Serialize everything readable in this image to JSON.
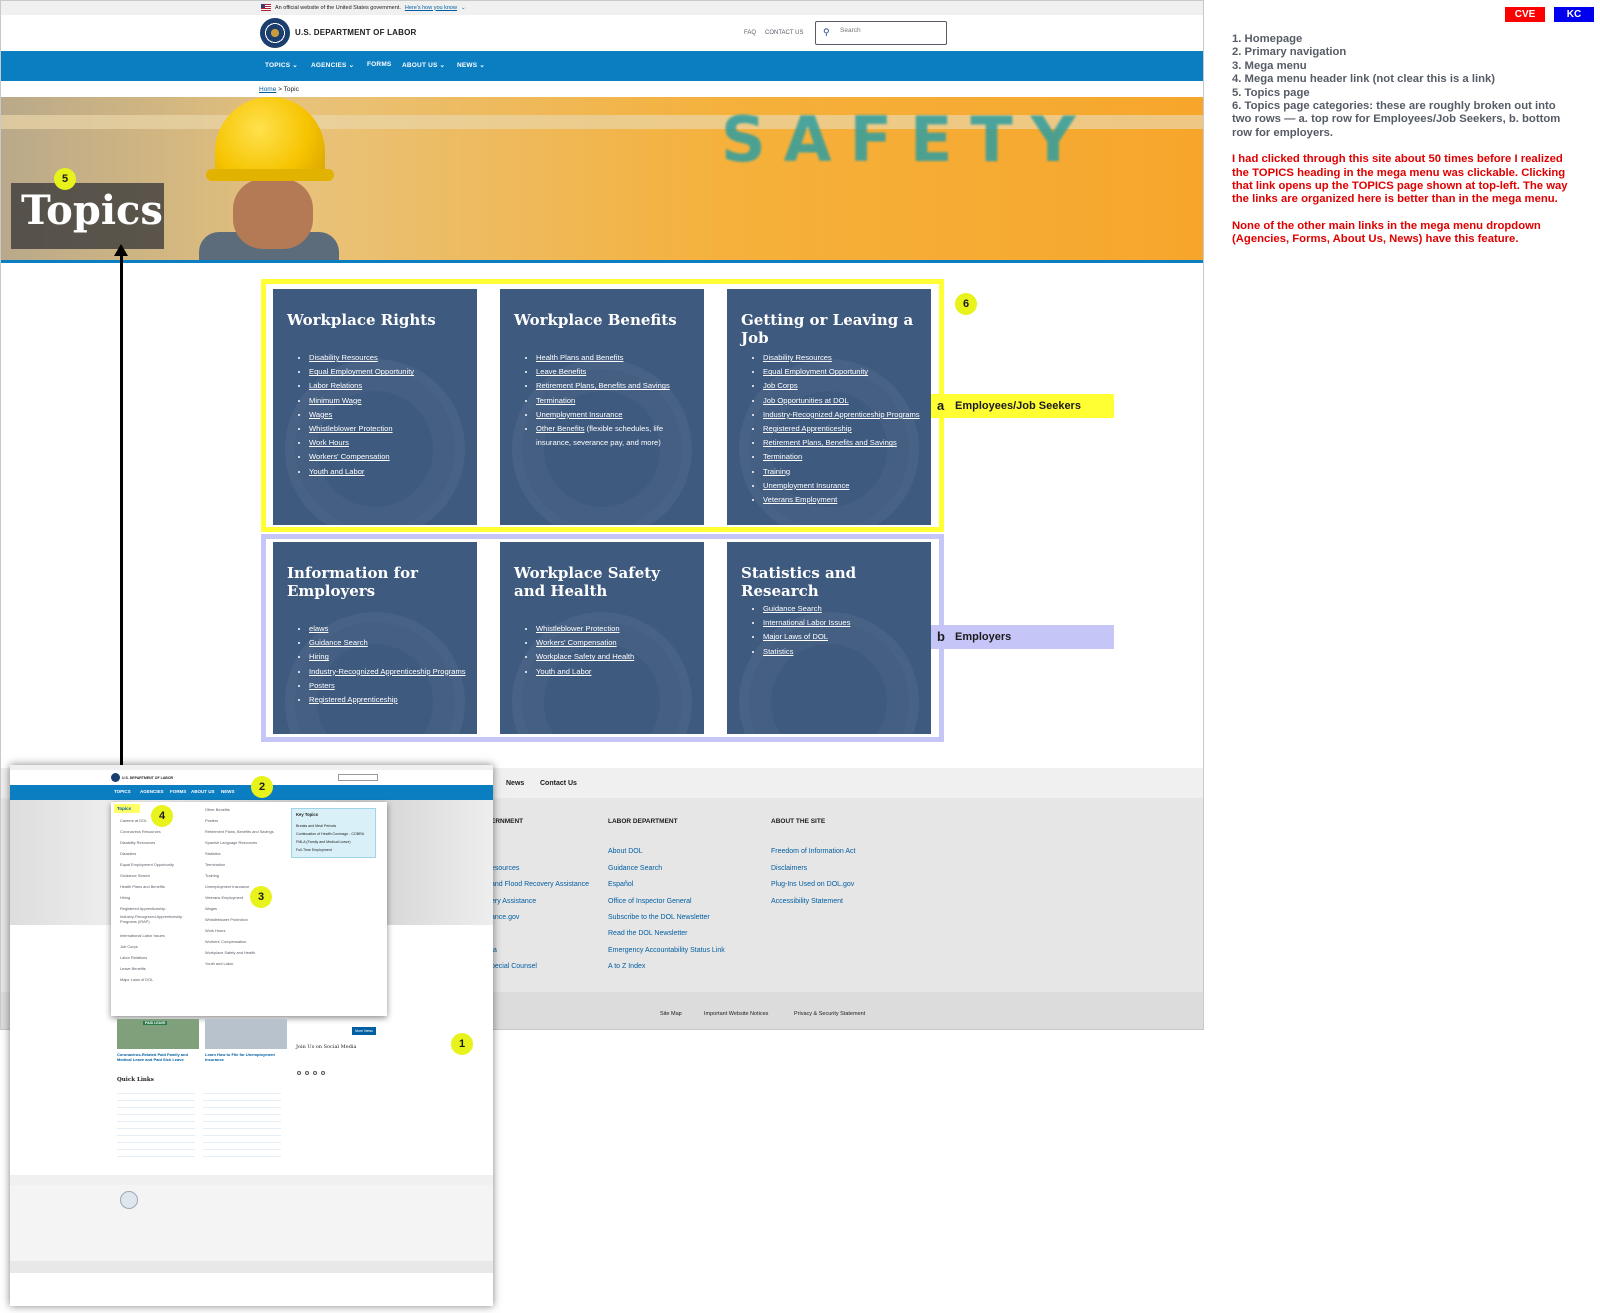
{
  "gov_banner": {
    "text": "An official website of the United States government.",
    "link": "Here's how you know"
  },
  "header": {
    "agency": "U.S. DEPARTMENT OF LABOR",
    "faq": "FAQ",
    "contact": "CONTACT US",
    "search_placeholder": "Search"
  },
  "nav": {
    "topics": "TOPICS",
    "agencies": "AGENCIES",
    "forms": "FORMS",
    "about": "ABOUT US",
    "news": "NEWS"
  },
  "breadcrumb": {
    "home": "Home",
    "current": "Topic"
  },
  "hero": {
    "title": "Topics",
    "sign_text": "SAFETY"
  },
  "cards": [
    {
      "title": "Workplace Rights",
      "links": [
        "Disability Resources",
        "Equal Employment Opportunity",
        "Labor Relations",
        "Minimum Wage",
        "Wages",
        "Whistleblower Protection",
        "Work Hours",
        "Workers' Compensation",
        "Youth and Labor"
      ]
    },
    {
      "title": "Workplace Benefits",
      "links": [
        "Health Plans and Benefits",
        "Leave Benefits",
        "Retirement Plans, Benefits and Savings",
        "Termination",
        "Unemployment Insurance",
        "Other Benefits"
      ],
      "other_desc": "(flexible schedules, life insurance, severance pay, and more)"
    },
    {
      "title": "Getting or Leaving a Job",
      "links": [
        "Disability Resources",
        "Equal Employment Opportunity",
        "Job Corps",
        "Job Opportunities at DOL",
        "Industry-Recognized Apprenticeship Programs",
        "Registered Apprenticeship",
        "Retirement Plans, Benefits and Savings",
        "Termination",
        "Training",
        "Unemployment Insurance",
        "Veterans Employment"
      ]
    },
    {
      "title": "Information for Employers",
      "links": [
        "elaws",
        "Guidance Search",
        "Hiring",
        "Industry-Recognized Apprenticeship Programs",
        "Posters",
        "Registered Apprenticeship"
      ]
    },
    {
      "title": "Workplace Safety and Health",
      "links": [
        "Whistleblower Protection",
        "Workers' Compensation",
        "Workplace Safety and Health",
        "Youth and Labor"
      ]
    },
    {
      "title": "Statistics and Research",
      "links": [
        "Guidance Search",
        "International Labor Issues",
        "Major Laws of DOL",
        "Statistics"
      ]
    }
  ],
  "annotations": {
    "badge_1": "1",
    "badge_2": "2",
    "badge_3": "3",
    "badge_4": "4",
    "badge_5": "5",
    "badge_6": "6",
    "tag_a_letter": "a",
    "tag_a_text": "Employees/Job Seekers",
    "tag_b_letter": "b",
    "tag_b_text": "Employers",
    "colors": {
      "yellow": "#ffff33",
      "lavender": "#c5c5f7",
      "badge": "#e8f21b",
      "red_note": "#e00000"
    }
  },
  "footer": {
    "nav": [
      "News",
      "Contact Us"
    ],
    "col1_header": "ERNMENT",
    "col1_links": [
      "esources",
      "and Flood Recovery Assistance",
      "ery Assistance",
      "ance.gov",
      "ta",
      "pecial Counsel"
    ],
    "col2_header": "LABOR DEPARTMENT",
    "col2_links": [
      "About DOL",
      "Guidance Search",
      "Español",
      "Office of Inspector General",
      "Subscribe to the DOL Newsletter",
      "Read the DOL Newsletter",
      "Emergency Accountability Status Link",
      "A to Z Index"
    ],
    "col3_header": "ABOUT THE SITE",
    "col3_links": [
      "Freedom of Information Act",
      "Disclaimers",
      "Plug-Ins Used on DOL.gov",
      "Accessibility Statement"
    ],
    "bottom_links": [
      "Site Map",
      "Important Website Notices",
      "Privacy & Security Statement"
    ]
  },
  "thumbnail": {
    "agency": "U.S. DEPARTMENT OF LABOR",
    "nav": [
      "TOPICS",
      "AGENCIES",
      "FORMS",
      "ABOUT US",
      "NEWS"
    ],
    "topics_link": "Topics",
    "mega_col1": [
      "Careers at DOL",
      "Coronavirus Resources",
      "Disability Resources",
      "Disasters",
      "Equal Employment Opportunity",
      "Guidance Search",
      "Health Plans and Benefits",
      "Hiring",
      "Registered Apprenticeship",
      "Industry-Recognized Apprenticeship Programs (IRAP)",
      "International Labor Issues",
      "Job Corps",
      "Labor Relations",
      "Leave Benefits",
      "Major Laws of DOL"
    ],
    "mega_col2": [
      "Other Benefits",
      "Posters",
      "Retirement Plans, Benefits and Savings",
      "Spanish Language Resources",
      "Statistics",
      "Termination",
      "Training",
      "Unemployment Insurance",
      "Veterans Employment",
      "Wages",
      "Whistleblower Protection",
      "Work Hours",
      "Workers' Compensation",
      "Workplace Safety and Health",
      "Youth and Labor"
    ],
    "key_topics": {
      "header": "Key Topics",
      "items": [
        "Breaks and Meal Periods",
        "Continuation of Health Coverage - COBRA",
        "FMLA (Family and Medical Leave)",
        "Full-Time Employment"
      ]
    },
    "card1_label": "Coronavirus-Related Paid Family and Medical Leave and Paid Sick Leave",
    "card2_label": "Learn How to File for Unemployment Insurance",
    "banner_label": "PAID LEAVE",
    "more_news": "More News",
    "social_title": "Join Us on Social Media",
    "quick_links": "Quick Links"
  },
  "notes": {
    "list": [
      "1. Homepage",
      "2. Primary navigation",
      "3. Mega menu",
      "4. Mega menu header link (not clear this is a link)",
      "5. Topics page",
      "6. Topics page categories: these are roughly broken out into two rows — a. top row for Employees/Job Seekers, b. bottom row for employers."
    ],
    "para1": "I had clicked through this site about 50 times before I realized the TOPICS heading in the mega menu was clickable. Clicking that link opens up the TOPICS page shown at top-left. The way the links are organized here is better than in the mega menu.",
    "para2": "None of the other main links in the mega menu dropdown (Agencies, Forms, About Us, News) have this feature."
  },
  "initials": {
    "cve": "CVE",
    "kc": "KC",
    "cve_color": "#ff0000",
    "kc_color": "#0000ee"
  }
}
